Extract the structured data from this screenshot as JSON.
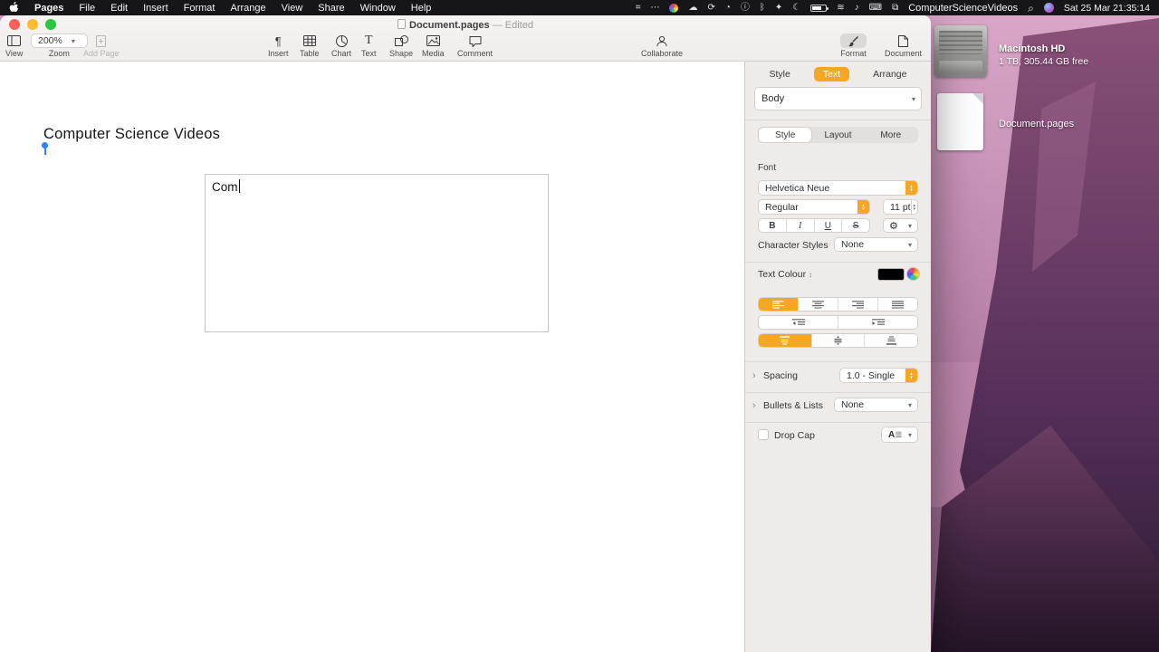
{
  "colors": {
    "accent": "#F5A623",
    "menubar_bg": "#161618",
    "sidebar_bg": "#EEEBE9"
  },
  "menu_bar": {
    "app": "Pages",
    "menus": [
      "File",
      "Edit",
      "Insert",
      "Format",
      "Arrange",
      "View",
      "Share",
      "Window",
      "Help"
    ],
    "status_title": "ComputerScienceVideos",
    "clock": "Sat 25 Mar 21:35:14"
  },
  "titlebar": {
    "title": "Document.pages",
    "edited": "—  Edited"
  },
  "toolbar": {
    "view": "View",
    "zoom_value": "200%",
    "zoom": "Zoom",
    "add_page": "Add Page",
    "insert": "Insert",
    "table": "Table",
    "chart": "Chart",
    "text": "Text",
    "shape": "Shape",
    "media": "Media",
    "comment": "Comment",
    "collaborate": "Collaborate",
    "format": "Format",
    "document": "Document"
  },
  "canvas": {
    "heading": "Computer Science Videos",
    "textbox_text": "Com"
  },
  "inspector": {
    "tab_style": "Style",
    "tab_text": "Text",
    "tab_arrange": "Arrange",
    "paragraph_style": "Body",
    "sub_style": "Style",
    "sub_layout": "Layout",
    "sub_more": "More",
    "font_label": "Font",
    "font_family": "Helvetica Neue",
    "font_weight": "Regular",
    "font_size": "11 pt",
    "bold": "B",
    "italic": "I",
    "underline": "U",
    "strike": "S",
    "char_styles_label": "Character Styles",
    "char_styles_value": "None",
    "text_colour_label": "Text Colour",
    "spacing_label": "Spacing",
    "spacing_value": "1.0 - Single",
    "bullets_label": "Bullets & Lists",
    "bullets_value": "None",
    "drop_cap_label": "Drop Cap",
    "drop_cap_glyph": "A"
  },
  "desktop": {
    "drive_name": "Macintosh HD",
    "drive_info": "1 TB, 305.44 GB free",
    "file_name": "Document.pages"
  },
  "icons": {
    "chevron_down": "▾",
    "chevron_right": "›",
    "stepper_up": "▴",
    "stepper_down": "▾",
    "paragraph": "¶",
    "gear": "⚙",
    "updown": "↕",
    "search": "⌕",
    "status_display": "⌗",
    "status_more": "⋯",
    "status_cloud": "☁",
    "status_sync": "⟳",
    "status_clock": "◔",
    "status_info": "ⓘ",
    "status_bluetooth": "ᛒ",
    "status_spark": "✦",
    "status_moon": "☾",
    "status_wifi": "≋",
    "status_sound": "♪",
    "status_keyboard": "⌨",
    "status_windows": "⧉"
  }
}
